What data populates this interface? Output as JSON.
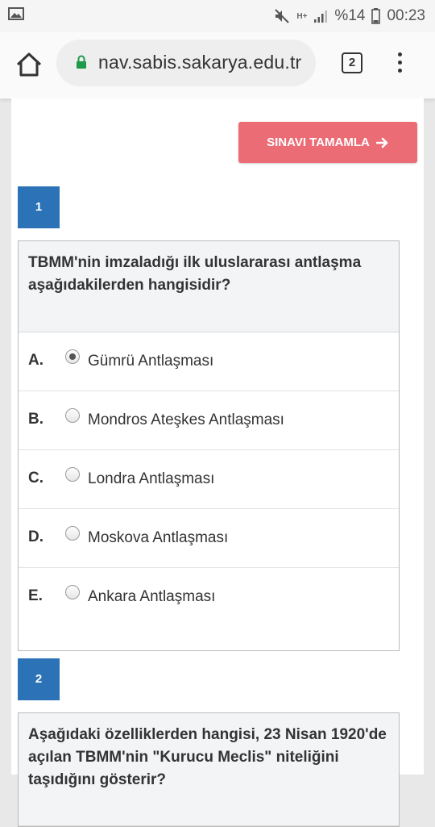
{
  "status_bar": {
    "network": "H+",
    "battery": "%14",
    "time": "00:23"
  },
  "browser": {
    "url": "nav.sabis.sakarya.edu.tr",
    "tab_count": "2"
  },
  "exam": {
    "finish_button": "SINAVI TAMAMLA",
    "questions": [
      {
        "number": "1",
        "text": "TBMM'nin imzaladığı ilk uluslararası antlaşma aşağıdakilerden hangisidir?",
        "options": [
          {
            "letter": "A.",
            "text": "Gümrü Antlaşması",
            "selected": true
          },
          {
            "letter": "B.",
            "text": "Mondros Ateşkes Antlaşması",
            "selected": false
          },
          {
            "letter": "C.",
            "text": "Londra Antlaşması",
            "selected": false
          },
          {
            "letter": "D.",
            "text": "Moskova Antlaşması",
            "selected": false
          },
          {
            "letter": "E.",
            "text": "Ankara Antlaşması",
            "selected": false
          }
        ]
      },
      {
        "number": "2",
        "text": "Aşağıdaki özelliklerden hangisi, 23 Nisan 1920'de açılan TBMM'nin \"Kurucu Meclis\" niteliğini taşıdığını gösterir?"
      }
    ]
  },
  "colors": {
    "finish_button_bg": "#ec6c76",
    "question_number_bg": "#2b72b7",
    "lock_icon": "#1e9a4a"
  }
}
